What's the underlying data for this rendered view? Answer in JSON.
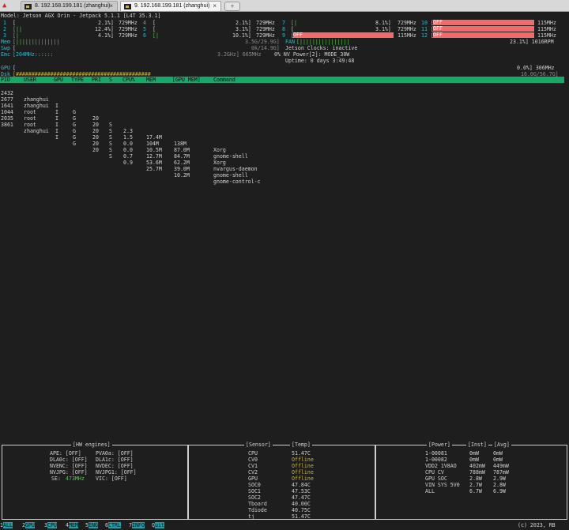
{
  "browser": {
    "tabs": [
      {
        "title": "8. 192.168.199.181 (zhanghui)",
        "close": "×"
      },
      {
        "title": "9. 192.168.199.181 (zhanghui)",
        "close": "×"
      }
    ],
    "home_glyph": "▲",
    "new_tab_glyph": "+"
  },
  "header": {
    "model": "Model: Jetson AGX Orin - Jetpack 5.1.1 [L4T 35.3.1]"
  },
  "cpus": [
    {
      "id": "1",
      "bar": "[",
      "pct": "2.1%]",
      "freq": "729MHz"
    },
    {
      "id": "2",
      "bar": "[||",
      "pct": "12.4%]",
      "freq": "729MHz"
    },
    {
      "id": "3",
      "bar": "[|",
      "pct": "4.1%]",
      "freq": "729MHz"
    },
    {
      "id": "4",
      "bar": "[",
      "pct": "2.1%]",
      "freq": "729MHz"
    },
    {
      "id": "5",
      "bar": "[",
      "pct": "3.1%]",
      "freq": "729MHz"
    },
    {
      "id": "6",
      "bar": "[|",
      "pct": "10.1%]",
      "freq": "729MHz"
    },
    {
      "id": "7",
      "bar": "[|",
      "pct": "8.1%]",
      "freq": "729MHz"
    },
    {
      "id": "8",
      "bar": "[",
      "pct": "3.1%]",
      "freq": "729MHz"
    },
    {
      "id": "9",
      "bar": "[",
      "off": "OFF",
      "freq": "115MHz"
    },
    {
      "id": "10",
      "bar": "[",
      "off": "OFF",
      "freq": "115MHz"
    },
    {
      "id": "11",
      "bar": "[",
      "off": "OFF",
      "freq": "115MHz"
    },
    {
      "id": "12",
      "bar": "[",
      "off": "OFF",
      "freq": "115MHz"
    }
  ],
  "mem": {
    "label": "Mem",
    "bar": "[||||||||||||||",
    "value": "3.5G/29.9G]"
  },
  "swp": {
    "label": "Swp",
    "bar": "[",
    "value": "0k/14.9G]"
  },
  "emc": {
    "label": "Emc",
    "bar": "[204MHz::::::",
    "value": "3.2GHz] 665MHz"
  },
  "fan": {
    "label": "FAN",
    "bar": "[||||||||||||||||",
    "value": "23.1%] 1016RPM"
  },
  "jetson_clocks": "Jetson Clocks: inactive",
  "nv_power": "0% NV Power[2]: MODE_30W",
  "uptime": "Uptime: 0 days 3:49:48",
  "gpu": {
    "label": "GPU",
    "bar": "[",
    "value": "0.0%] 306MHz"
  },
  "dsk": {
    "label": "Dsk",
    "bar": "[###########################################",
    "value": "16.0G/56.7G]"
  },
  "process_table": {
    "headers": [
      "PID",
      "USER",
      "GPU",
      "TYPE",
      "PRI",
      "S",
      "CPU%",
      "MEM",
      "[GPU MEM]",
      "Command"
    ],
    "rows": [
      [
        "2432",
        "zhanghui",
        "I",
        "G",
        "20",
        "S",
        "2.3",
        "17.4M",
        "138M",
        "Xorg"
      ],
      [
        "2677",
        "zhanghui",
        "I",
        "G",
        "20",
        "S",
        "1.5",
        "104M",
        "87.0M",
        "gnome-shell"
      ],
      [
        "1641",
        "root",
        "I",
        "G",
        "20",
        "S",
        "0.0",
        "10.5M",
        "84.7M",
        "Xorg"
      ],
      [
        "1044",
        "root",
        "I",
        "G",
        "20",
        "S",
        "0.0",
        "12.7M",
        "62.2M",
        "nvargus-daemon"
      ],
      [
        "2035",
        "root",
        "I",
        "G",
        "20",
        "S",
        "0.7",
        "53.6M",
        "39.0M",
        "gnome-shell"
      ],
      [
        "3861",
        "zhanghui",
        "I",
        "G",
        "20",
        "S",
        "0.9",
        "25.7M",
        "10.2M",
        "gnome-control-c"
      ]
    ]
  },
  "hw_engines": {
    "title": "[HW engines]",
    "rows": [
      [
        "APE: [OFF]",
        "PVA0a: [OFF]"
      ],
      [
        "DLA0c: [OFF]",
        "DLA1c: [OFF]"
      ],
      [
        "NVENC: [OFF]",
        "NVDEC: [OFF]"
      ],
      [
        "NVJPG: [OFF]",
        "NVJPG1: [OFF]"
      ],
      [
        "SE:",
        "473MHz",
        "VIC: [OFF]"
      ]
    ]
  },
  "sensors": {
    "title_sensor": "[Sensor]",
    "title_temp": "[Temp]",
    "rows": [
      [
        "CPU",
        "51.47C"
      ],
      [
        "CV0",
        "Offline"
      ],
      [
        "CV1",
        "Offline"
      ],
      [
        "CV2",
        "Offline"
      ],
      [
        "GPU",
        "Offline"
      ],
      [
        "SOC0",
        "47.84C"
      ],
      [
        "SOC1",
        "47.53C"
      ],
      [
        "SOC2",
        "47.47C"
      ],
      [
        "Tboard",
        "40.00C"
      ],
      [
        "Tdiode",
        "40.75C"
      ],
      [
        "tj",
        "51.47C"
      ]
    ]
  },
  "power": {
    "title_power": "[Power]",
    "title_inst": "[Inst]",
    "title_avg": "[Avg]",
    "rows": [
      [
        "1-00081",
        "0mW",
        "0mW"
      ],
      [
        "1-00082",
        "0mW",
        "0mW"
      ],
      [
        "VDD2 1V8AO",
        "402mW",
        "449mW"
      ],
      [
        "CPU CV",
        "788mW",
        "787mW"
      ],
      [
        "GPU SOC",
        "2.8W",
        "2.9W"
      ],
      [
        "VIN SYS 5V0",
        "2.7W",
        "2.8W"
      ],
      [
        "ALL",
        "6.7W",
        "6.9W"
      ]
    ]
  },
  "fkeys": [
    {
      "key": "1",
      "label": "ALL"
    },
    {
      "key": "2",
      "label": "GPU"
    },
    {
      "key": "3",
      "label": "CPU"
    },
    {
      "key": "4",
      "label": "MEM"
    },
    {
      "key": "5",
      "label": "ENG"
    },
    {
      "key": "6",
      "label": "CTRL"
    },
    {
      "key": "7",
      "label": "INFO"
    },
    {
      "key": "Q",
      "label": "uit"
    }
  ],
  "copyright": "(c) 2023, RB"
}
